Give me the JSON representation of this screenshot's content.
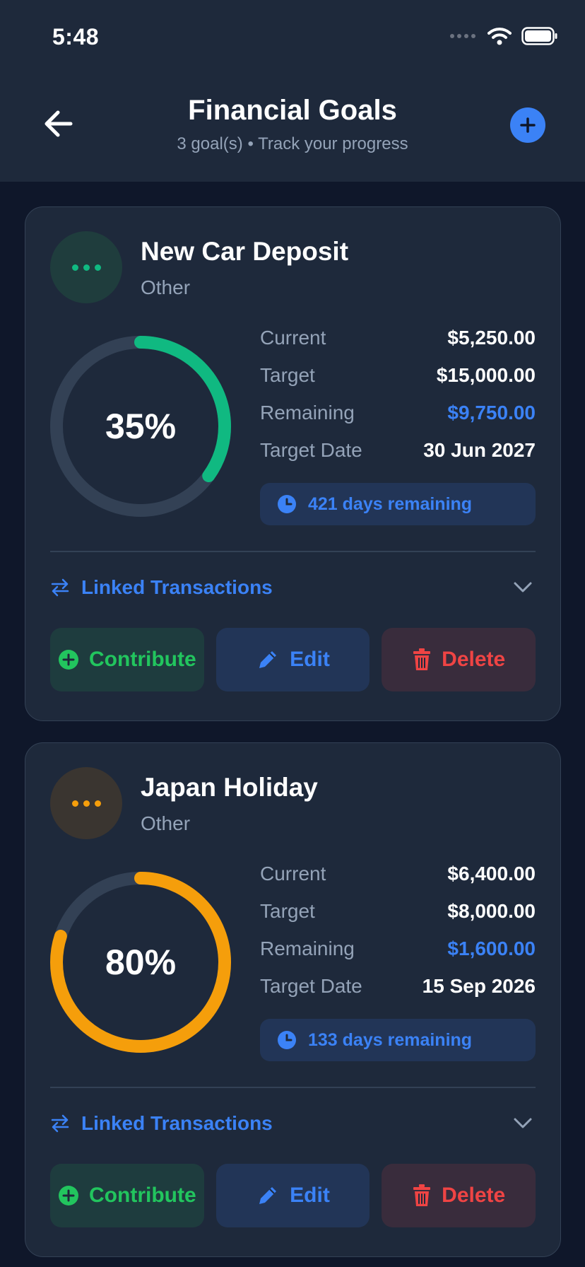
{
  "status_bar": {
    "time": "5:48"
  },
  "header": {
    "title": "Financial Goals",
    "subtitle": "3 goal(s) • Track your progress"
  },
  "labels": {
    "current": "Current",
    "target": "Target",
    "remaining": "Remaining",
    "target_date": "Target Date",
    "linked_transactions": "Linked Transactions",
    "contribute": "Contribute",
    "edit": "Edit",
    "delete": "Delete"
  },
  "goals": [
    {
      "name": "New Car Deposit",
      "category": "Other",
      "percent_label": "35%",
      "progress": 0.35,
      "current": "$5,250.00",
      "target": "$15,000.00",
      "remaining": "$9,750.00",
      "target_date": "30 Jun 2027",
      "days_remaining": "421 days remaining",
      "accent_color": "#10b981",
      "icon_bg": "#1f3d3d"
    },
    {
      "name": "Japan Holiday",
      "category": "Other",
      "percent_label": "80%",
      "progress": 0.8,
      "current": "$6,400.00",
      "target": "$8,000.00",
      "remaining": "$1,600.00",
      "target_date": "15 Sep 2026",
      "days_remaining": "133 days remaining",
      "accent_color": "#f59e0b",
      "icon_bg": "#3a3530"
    }
  ],
  "colors": {
    "background": "#0f172a",
    "surface": "#1e293b",
    "primary": "#3b82f6",
    "success": "#22c55e",
    "danger": "#ef4444"
  },
  "icons": {
    "back": "arrow-left-icon",
    "add": "plus-icon",
    "goal": "more-dots-icon",
    "clock": "clock-icon",
    "linked": "swap-arrows-icon",
    "expand": "chevron-down-icon",
    "contribute": "plus-circle-icon",
    "edit": "pencil-icon",
    "delete": "trash-icon"
  }
}
